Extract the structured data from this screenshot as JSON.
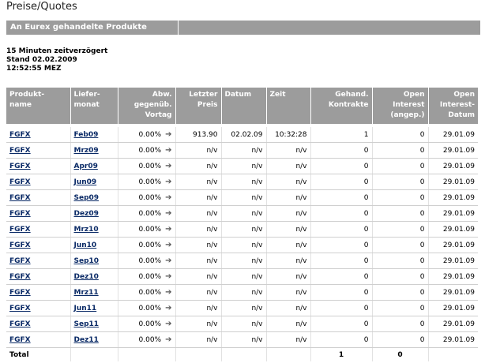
{
  "page": {
    "title": "Preise/Quotes"
  },
  "section": {
    "title": "An Eurex gehandelte Produkte"
  },
  "info": {
    "delay": "15 Minuten zeitverzögert",
    "stand": "Stand 02.02.2009",
    "time": "12:52:55 MEZ"
  },
  "table": {
    "headers": {
      "product": [
        "Produkt-",
        "name"
      ],
      "delivery": [
        "Liefer-",
        "monat"
      ],
      "change": [
        "Abw.",
        "gegenüb.",
        "Vortag"
      ],
      "last": [
        "Letzter",
        "Preis"
      ],
      "date": [
        "Datum"
      ],
      "time": [
        "Zeit"
      ],
      "volume": [
        "Gehand.",
        "Kontrakte"
      ],
      "oi_adj": [
        "Open",
        "Interest",
        "(angep.)"
      ],
      "oi_date": [
        "Open",
        "Interest-",
        "Datum"
      ]
    },
    "rows": [
      {
        "product": "FGFX",
        "month": "Feb09",
        "change": "0.00%",
        "last": "913.90",
        "date": "02.02.09",
        "time": "10:32:28",
        "volume": "1",
        "oi": "0",
        "oi_date": "29.01.09"
      },
      {
        "product": "FGFX",
        "month": "Mrz09",
        "change": "0.00%",
        "last": "n/v",
        "date": "n/v",
        "time": "n/v",
        "volume": "0",
        "oi": "0",
        "oi_date": "29.01.09"
      },
      {
        "product": "FGFX",
        "month": "Apr09",
        "change": "0.00%",
        "last": "n/v",
        "date": "n/v",
        "time": "n/v",
        "volume": "0",
        "oi": "0",
        "oi_date": "29.01.09"
      },
      {
        "product": "FGFX",
        "month": "Jun09",
        "change": "0.00%",
        "last": "n/v",
        "date": "n/v",
        "time": "n/v",
        "volume": "0",
        "oi": "0",
        "oi_date": "29.01.09"
      },
      {
        "product": "FGFX",
        "month": "Sep09",
        "change": "0.00%",
        "last": "n/v",
        "date": "n/v",
        "time": "n/v",
        "volume": "0",
        "oi": "0",
        "oi_date": "29.01.09"
      },
      {
        "product": "FGFX",
        "month": "Dez09",
        "change": "0.00%",
        "last": "n/v",
        "date": "n/v",
        "time": "n/v",
        "volume": "0",
        "oi": "0",
        "oi_date": "29.01.09"
      },
      {
        "product": "FGFX",
        "month": "Mrz10",
        "change": "0.00%",
        "last": "n/v",
        "date": "n/v",
        "time": "n/v",
        "volume": "0",
        "oi": "0",
        "oi_date": "29.01.09"
      },
      {
        "product": "FGFX",
        "month": "Jun10",
        "change": "0.00%",
        "last": "n/v",
        "date": "n/v",
        "time": "n/v",
        "volume": "0",
        "oi": "0",
        "oi_date": "29.01.09"
      },
      {
        "product": "FGFX",
        "month": "Sep10",
        "change": "0.00%",
        "last": "n/v",
        "date": "n/v",
        "time": "n/v",
        "volume": "0",
        "oi": "0",
        "oi_date": "29.01.09"
      },
      {
        "product": "FGFX",
        "month": "Dez10",
        "change": "0.00%",
        "last": "n/v",
        "date": "n/v",
        "time": "n/v",
        "volume": "0",
        "oi": "0",
        "oi_date": "29.01.09"
      },
      {
        "product": "FGFX",
        "month": "Mrz11",
        "change": "0.00%",
        "last": "n/v",
        "date": "n/v",
        "time": "n/v",
        "volume": "0",
        "oi": "0",
        "oi_date": "29.01.09"
      },
      {
        "product": "FGFX",
        "month": "Jun11",
        "change": "0.00%",
        "last": "n/v",
        "date": "n/v",
        "time": "n/v",
        "volume": "0",
        "oi": "0",
        "oi_date": "29.01.09"
      },
      {
        "product": "FGFX",
        "month": "Sep11",
        "change": "0.00%",
        "last": "n/v",
        "date": "n/v",
        "time": "n/v",
        "volume": "0",
        "oi": "0",
        "oi_date": "29.01.09"
      },
      {
        "product": "FGFX",
        "month": "Dez11",
        "change": "0.00%",
        "last": "n/v",
        "date": "n/v",
        "time": "n/v",
        "volume": "0",
        "oi": "0",
        "oi_date": "29.01.09"
      }
    ],
    "total": {
      "label": "Total",
      "volume": "1",
      "oi": "0"
    }
  },
  "icons": {
    "change_arrow": "arrow-right-icon"
  },
  "colors": {
    "header_bg": "#9c9c9c",
    "link": "#0a2a66"
  }
}
